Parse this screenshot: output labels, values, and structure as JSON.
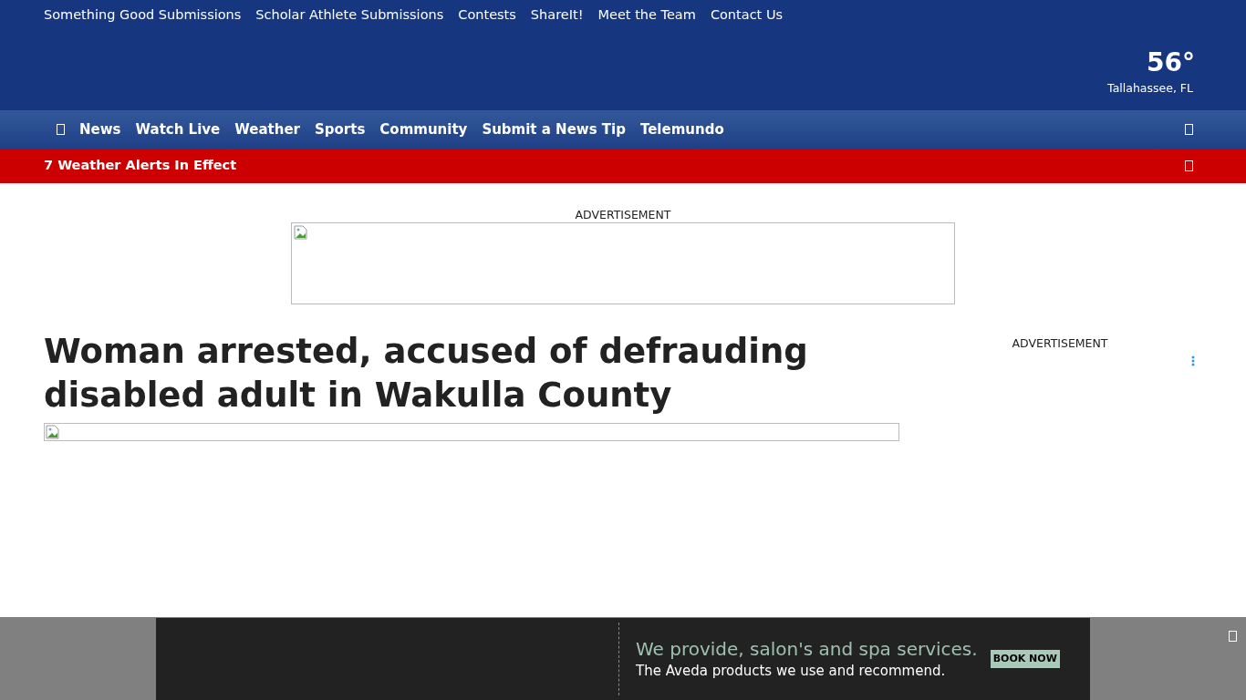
{
  "top_links": [
    "Something Good Submissions",
    "Scholar Athlete Submissions",
    "Contests",
    "ShareIt!",
    "Meet the Team",
    "Contact Us"
  ],
  "weather": {
    "temperature": "56°",
    "location": "Tallahassee, FL"
  },
  "nav": {
    "items": [
      "News",
      "Watch Live",
      "Weather",
      "Sports",
      "Community",
      "Submit a News Tip",
      "Telemundo"
    ]
  },
  "alert_bar": {
    "text": "7 Weather Alerts In Effect"
  },
  "top_ad": {
    "label": "ADVERTISEMENT"
  },
  "article": {
    "headline": "Woman arrested, accused of defrauding disabled adult in Wakulla County"
  },
  "side_ad": {
    "label": "ADVERTISEMENT"
  },
  "bottom_ad": {
    "headline": "We provide, salon's and spa services.",
    "subline": "The Aveda products we use and recommend.",
    "button": "BOOK NOW"
  }
}
